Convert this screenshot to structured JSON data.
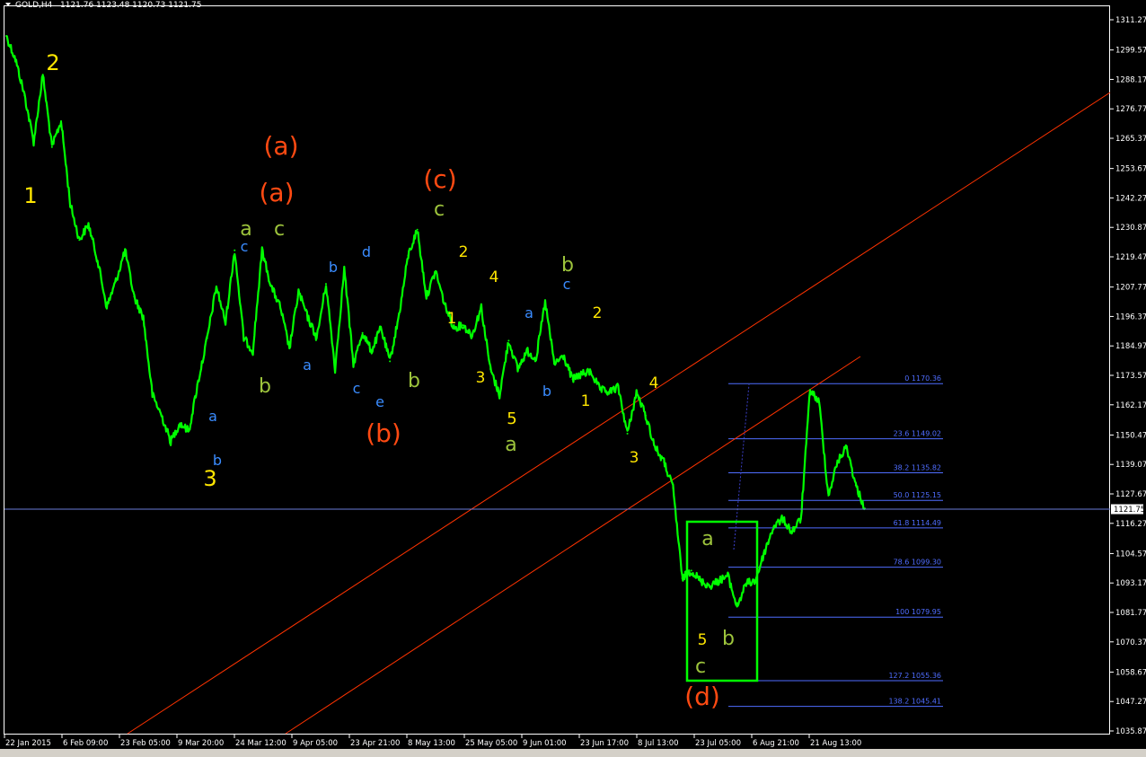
{
  "header": {
    "symbol": "GOLD,H4",
    "ohlc": "1121.76 1123.48 1120.73 1121.75"
  },
  "colors": {
    "background": "#000000",
    "candles": "#00ff00",
    "trendline": "#ff3300",
    "fibonacci": "#4f6dff",
    "box": "#00ff00",
    "price_line": "#6a7bd8",
    "wave_yellow": "#ffe600",
    "wave_orange": "#ff4a12",
    "wave_olive": "#9dc43c",
    "wave_blue": "#3a8cff"
  },
  "chart_data": {
    "type": "line",
    "title": "GOLD,H4",
    "xlabel": "",
    "ylabel": "",
    "ylim": [
      1035.87,
      1315.0
    ],
    "current_price": 1121.75,
    "x_ticks": [
      "22 Jan 2015",
      "6 Feb 09:00",
      "23 Feb 05:00",
      "9 Mar 20:00",
      "24 Mar 12:00",
      "9 Apr 05:00",
      "23 Apr 21:00",
      "8 May 13:00",
      "25 May 05:00",
      "9 Jun 01:00",
      "23 Jun 17:00",
      "8 Jul 13:00",
      "23 Jul 05:00",
      "6 Aug 21:00",
      "21 Aug 13:00"
    ],
    "y_ticks": [
      1311.27,
      1299.57,
      1288.17,
      1276.77,
      1265.37,
      1253.67,
      1242.27,
      1230.87,
      1219.47,
      1207.77,
      1196.37,
      1184.97,
      1173.57,
      1162.17,
      1150.47,
      1139.07,
      1127.67,
      1116.27,
      1104.57,
      1093.17,
      1081.77,
      1070.37,
      1058.67,
      1047.27,
      1035.87
    ],
    "series": [
      {
        "x": [
          "22 Jan",
          "24 Jan",
          "27 Jan",
          "29 Jan",
          "31 Jan",
          "3 Feb",
          "5 Feb",
          "8 Feb",
          "11 Feb",
          "13 Feb",
          "15 Feb",
          "18 Feb",
          "21 Feb",
          "24 Feb",
          "27 Feb",
          "2 Mar",
          "5 Mar",
          "8 Mar",
          "10 Mar",
          "12 Mar",
          "14 Mar",
          "16 Mar",
          "18 Mar",
          "20 Mar",
          "22 Mar",
          "24 Mar",
          "26 Mar",
          "28 Mar",
          "31 Mar",
          "2 Apr",
          "5 Apr",
          "7 Apr",
          "10 Apr",
          "12 Apr",
          "15 Apr",
          "17 Apr",
          "20 Apr",
          "22 Apr",
          "24 Apr",
          "27 Apr",
          "29 Apr",
          "1 May",
          "4 May",
          "6 May",
          "8 May",
          "11 May",
          "13 May",
          "15 May",
          "17 May",
          "19 May",
          "21 May",
          "23 May",
          "26 May",
          "28 May",
          "31 May",
          "3 Jun",
          "6 Jun",
          "9 Jun",
          "11 Jun",
          "13 Jun",
          "15 Jun",
          "17 Jun",
          "19 Jun",
          "22 Jun",
          "25 Jun",
          "28 Jun",
          "30 Jun",
          "3 Jul",
          "6 Jul",
          "8 Jul",
          "10 Jul",
          "13 Jul",
          "15 Jul",
          "17 Jul",
          "19 Jul",
          "21 Jul",
          "23 Jul",
          "25 Jul",
          "27 Jul",
          "29 Jul",
          "31 Jul",
          "2 Aug",
          "5 Aug",
          "7 Aug",
          "10 Aug",
          "12 Aug",
          "14 Aug",
          "16 Aug",
          "18 Aug",
          "20 Aug",
          "22 Aug",
          "24 Aug",
          "26 Aug",
          "28 Aug",
          "30 Aug"
        ],
        "values": [
          1305,
          1296,
          1282,
          1264,
          1290,
          1262,
          1272,
          1240,
          1226,
          1232,
          1218,
          1200,
          1210,
          1222,
          1204,
          1196,
          1166,
          1158,
          1148,
          1155,
          1152,
          1171,
          1188,
          1208,
          1194,
          1222,
          1188,
          1183,
          1222,
          1208,
          1200,
          1184,
          1206,
          1196,
          1188,
          1209,
          1176,
          1215,
          1178,
          1190,
          1183,
          1192,
          1179,
          1197,
          1220,
          1230,
          1204,
          1214,
          1201,
          1192,
          1193,
          1189,
          1200,
          1176,
          1166,
          1187,
          1176,
          1183,
          1180,
          1202,
          1178,
          1181,
          1172,
          1174,
          1175,
          1168,
          1167,
          1169,
          1151,
          1167,
          1158,
          1146,
          1140,
          1130,
          1095,
          1098,
          1094,
          1092,
          1094,
          1096,
          1084,
          1093,
          1094,
          1105,
          1115,
          1118,
          1113,
          1118,
          1168,
          1163,
          1127,
          1140,
          1146,
          1131,
          1122
        ]
      }
    ],
    "fibonacci_levels": [
      {
        "label": "0 1170.36",
        "value": 1170.36
      },
      {
        "label": "23.6 1149.02",
        "value": 1149.02
      },
      {
        "label": "38.2 1135.82",
        "value": 1135.82
      },
      {
        "label": "50.0 1125.15",
        "value": 1125.15
      },
      {
        "label": "61.8 1114.49",
        "value": 1114.49
      },
      {
        "label": "78.6 1099.30",
        "value": 1099.3
      },
      {
        "label": "100 1079.95",
        "value": 1079.95
      },
      {
        "label": "127.2 1055.36",
        "value": 1055.36
      },
      {
        "label": "138.2 1045.41",
        "value": 1045.41
      }
    ],
    "wave_labels": [
      {
        "text": "2",
        "color": "yellow"
      },
      {
        "text": "1",
        "color": "yellow"
      },
      {
        "text": "(a)",
        "color": "orange"
      },
      {
        "text": "(a)",
        "color": "orange"
      },
      {
        "text": "(c)",
        "color": "orange"
      },
      {
        "text": "c",
        "color": "olive"
      },
      {
        "text": "a",
        "color": "olive"
      },
      {
        "text": "c",
        "color": "olive"
      },
      {
        "text": "c",
        "color": "blue"
      },
      {
        "text": "b",
        "color": "blue"
      },
      {
        "text": "d",
        "color": "blue"
      },
      {
        "text": "2",
        "color": "yellow"
      },
      {
        "text": "4",
        "color": "yellow"
      },
      {
        "text": "b",
        "color": "olive"
      },
      {
        "text": "c",
        "color": "blue"
      },
      {
        "text": "1",
        "color": "yellow"
      },
      {
        "text": "a",
        "color": "blue"
      },
      {
        "text": "2",
        "color": "yellow"
      },
      {
        "text": "a",
        "color": "blue"
      },
      {
        "text": "a",
        "color": "blue"
      },
      {
        "text": "b",
        "color": "olive"
      },
      {
        "text": "3",
        "color": "yellow"
      },
      {
        "text": "b",
        "color": "olive"
      },
      {
        "text": "c",
        "color": "blue"
      },
      {
        "text": "e",
        "color": "blue"
      },
      {
        "text": "b",
        "color": "blue"
      },
      {
        "text": "1",
        "color": "yellow"
      },
      {
        "text": "4",
        "color": "yellow"
      },
      {
        "text": "5",
        "color": "yellow"
      },
      {
        "text": "a",
        "color": "olive"
      },
      {
        "text": "(b)",
        "color": "orange"
      },
      {
        "text": "b",
        "color": "blue"
      },
      {
        "text": "3",
        "color": "yellow"
      },
      {
        "text": "3",
        "color": "yellow"
      },
      {
        "text": "a",
        "color": "olive"
      },
      {
        "text": "5",
        "color": "yellow"
      },
      {
        "text": "b",
        "color": "olive"
      },
      {
        "text": "c",
        "color": "olive"
      },
      {
        "text": "(d)",
        "color": "orange"
      }
    ]
  }
}
